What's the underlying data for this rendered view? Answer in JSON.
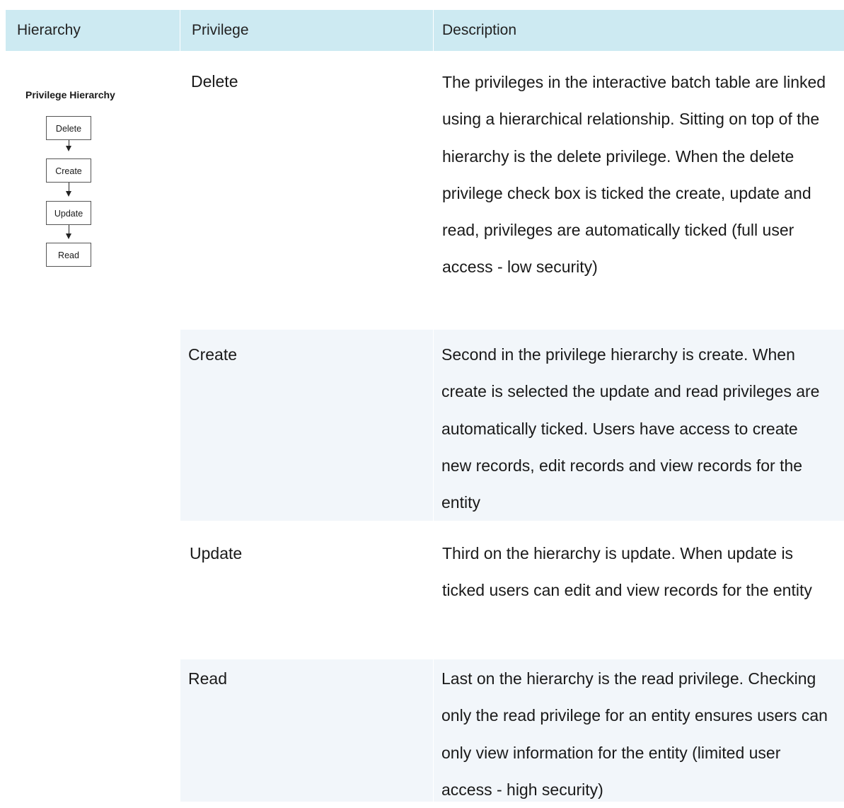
{
  "table": {
    "headers": {
      "hierarchy": "Hierarchy",
      "privilege": "Privilege",
      "description": "Description"
    },
    "diagram": {
      "title": "Privilege Hierarchy",
      "boxes": [
        "Delete",
        "Create",
        "Update",
        "Read"
      ]
    },
    "rows": [
      {
        "privilege": "Delete",
        "description": "The privileges in the interactive batch table are linked using a hierarchical relationship. Sitting on top of the hierarchy is the delete privilege. When the delete privilege check box is ticked the create, update and read, privileges are automatically ticked (full user access - low security)"
      },
      {
        "privilege": "Create",
        "description": "Second in the privilege hierarchy is create. When create is selected the update and read privileges are automatically ticked. Users have access to create new records, edit records and view records for the entity"
      },
      {
        "privilege": "Update",
        "description": "Third on the hierarchy is update. When update is ticked users can edit and view records for the entity"
      },
      {
        "privilege": "Read",
        "description": "Last on the hierarchy is the read privilege. Checking only the read privilege for an entity ensures users can only view information for the entity (limited user access - high security)"
      }
    ]
  }
}
